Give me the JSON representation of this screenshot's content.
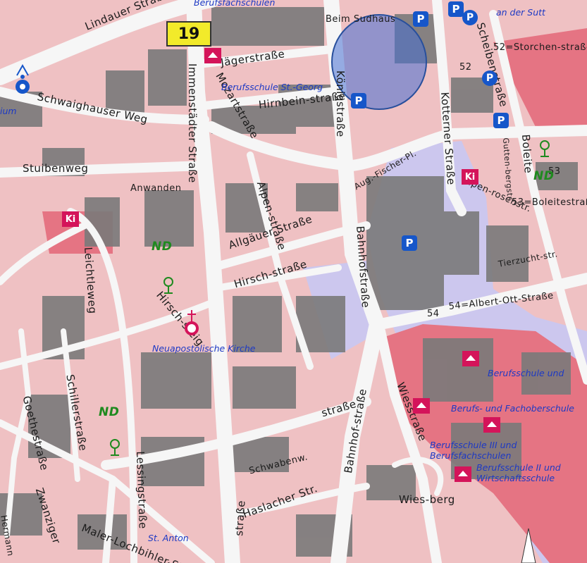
{
  "map": {
    "route_badge": "19",
    "streets": [
      "Lindauer Straße",
      "Jägerstraße",
      "Hirnbein-straße",
      "Königstraße",
      "Mozartstraße",
      "Immenstädter Straße",
      "Schwaighauser Weg",
      "Stuibenweg",
      "Anwanden",
      "Alpen-straße",
      "Allgäuer Straße",
      "Hirsch-straße",
      "Hirsch-steig",
      "Bahnhofstraße",
      "Bahnhof-straße",
      "Aug.-Fischer-Pl.",
      "Kotterner Straße",
      "Scheibenstraße",
      "Boleite",
      "Gutten-bergstr.",
      "Alpen-rosenstr.",
      "53=Boleitestraße",
      "52=Storchen-straße",
      "52",
      "53",
      "54",
      "54=Albert-Ott-Straße",
      "Tierzucht-str.",
      "Leichtleweg",
      "Schillerstraße",
      "Goethestraße",
      "Lessingstraße",
      "Schwabenw.",
      "Haslacher Str.",
      "Wies-berg",
      "Wiesstraße",
      "straße",
      "Maler-Lochbihler-Str.",
      "Zwanziger",
      "Hermann",
      "Beim Sudhaus",
      "straße"
    ],
    "blue_labels": [
      "Berufsschule St.-Georg",
      "Berufsfachschulen",
      "Neuapostolische Kirche",
      "St. Anton",
      "Berufsschule und",
      "Berufs- und Fachoberschule",
      "Berufsschule III und Berufsfachschulen",
      "Berufsschule II und Wirtschaftsschule",
      "an der Sutt",
      "ium"
    ],
    "nd_labels": [
      "ND",
      "ND",
      "ND"
    ],
    "poi_labels": {
      "ki": "Ki",
      "parking": "P"
    },
    "colors": {
      "residential": "#efc1c3",
      "building": "#7b7b7b",
      "road": "#f4f4f4",
      "school_area": "#e86a78",
      "station_area": "#c9c8ef",
      "selection": "#466ed2"
    }
  }
}
